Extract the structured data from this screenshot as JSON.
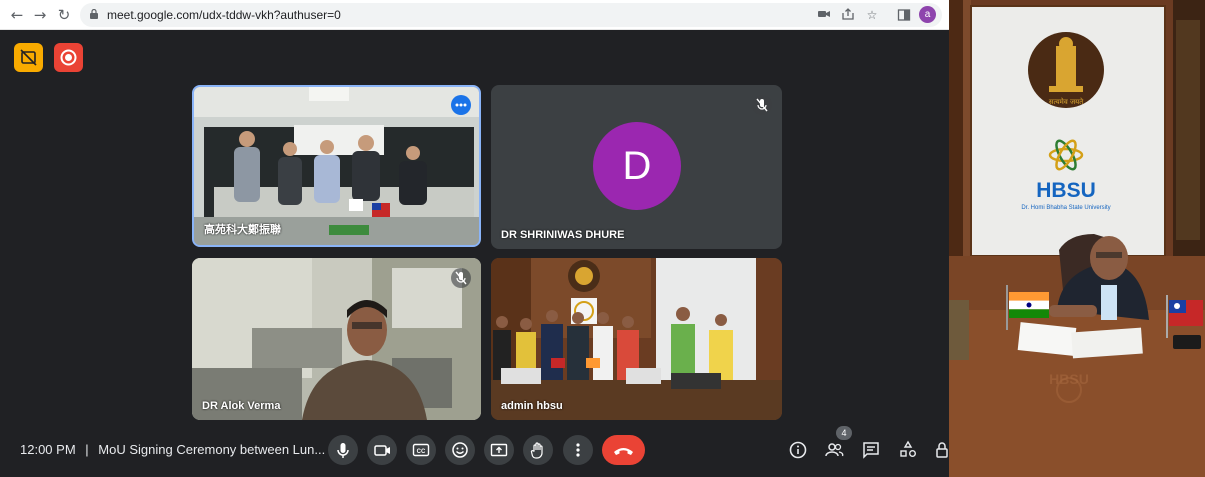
{
  "browser": {
    "url": "meet.google.com/udx-tddw-vkh?authuser=0",
    "profile_initial": "a",
    "profile_color": "#8e44ad"
  },
  "meet": {
    "background": "#202124",
    "tiles": [
      {
        "name": "高苑科大鄭振聯",
        "kind": "video"
      },
      {
        "name": "DR SHRINIWAS DHURE",
        "kind": "avatar",
        "initial": "D",
        "avatar_color": "#9b27b0",
        "muted": true
      },
      {
        "name": "DR Alok Verma",
        "kind": "video",
        "muted": true
      },
      {
        "name": "admin hbsu",
        "kind": "video"
      }
    ],
    "bottom": {
      "time": "12:00 PM",
      "separator": "|",
      "meeting_title": "MoU Signing Ceremony between Lun...",
      "participant_count": "4"
    },
    "end_call_color": "#ea4335",
    "record_color": "#ea4335",
    "captions_off_color": "#f9ab00"
  },
  "camera_feed": {
    "emblem_motto": "सत्यमेव जयते",
    "university_short": "HBSU",
    "university_full": "Dr. Homi Bhabha State University",
    "nameplate_text": "HBSU"
  }
}
